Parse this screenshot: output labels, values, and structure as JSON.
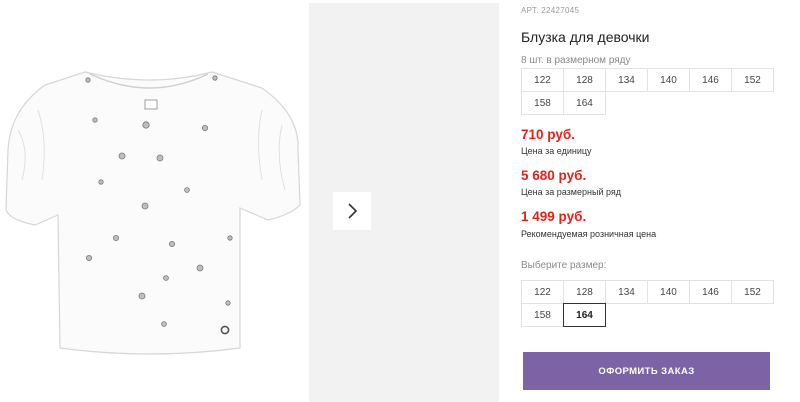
{
  "product": {
    "article_label": "АРТ.",
    "article_number": "22427045",
    "title": "Блузка для девочки"
  },
  "pack": {
    "label": "8 шт. в размерном ряду",
    "sizes": [
      "122",
      "128",
      "134",
      "140",
      "146",
      "152",
      "158",
      "164"
    ]
  },
  "prices": {
    "unit_price": "710 руб.",
    "unit_label": "Цена за единицу",
    "row_price": "5 680 руб.",
    "row_label": "Цена за размерный ряд",
    "retail_price": "1 499 руб.",
    "retail_label": "Рекомендуемая розничная цена",
    "accent_color": "#e2231a"
  },
  "size_select": {
    "label": "Выберите размер:",
    "sizes": [
      "122",
      "128",
      "134",
      "140",
      "146",
      "152",
      "158",
      "164"
    ],
    "selected": "164"
  },
  "order_button": {
    "label": "ОФОРМИТЬ ЗАКАЗ",
    "color": "#7b63a5"
  },
  "gallery": {
    "main_image": "white-girls-blouse-with-puff-sleeves",
    "next_icon": "chevron-right-icon"
  }
}
